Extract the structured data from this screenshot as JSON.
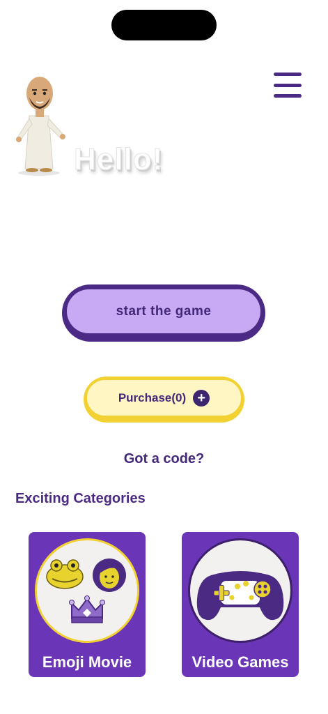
{
  "header": {
    "greeting": "Hello!",
    "menu_icon": "hamburger-menu-icon",
    "avatar_icon": "character-avatar"
  },
  "actions": {
    "start_label": "start the game",
    "purchase_label": "Purchase(0)",
    "purchase_icon": "plus-circle-icon",
    "code_link": "Got a code?"
  },
  "categories": {
    "title": "Exciting Categories",
    "items": [
      {
        "label": "Emoji Movie",
        "icon": "emoji-collage-icon"
      },
      {
        "label": "Video Games",
        "icon": "gamepad-icon"
      }
    ]
  },
  "colors": {
    "primary": "#4b2a86",
    "primary_light": "#c8a9f3",
    "accent_yellow": "#f2d233",
    "card_purple": "#6b35b8"
  }
}
